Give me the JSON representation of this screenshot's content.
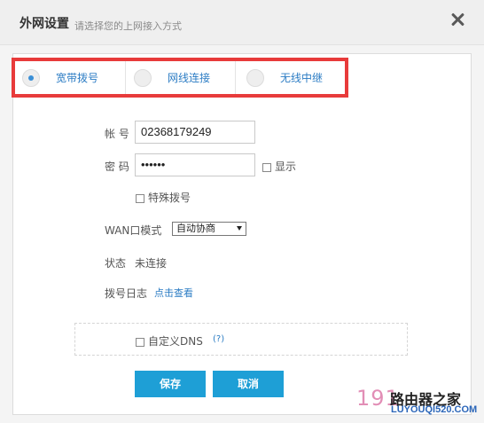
{
  "dialog": {
    "title": "外网设置",
    "subtitle": "请选择您的上网接入方式"
  },
  "tabs": [
    {
      "label": "宽带拨号",
      "selected": true
    },
    {
      "label": "网线连接",
      "selected": false
    },
    {
      "label": "无线中继",
      "selected": false
    }
  ],
  "form": {
    "account_label": "帐 号",
    "account_value": "02368179249",
    "password_label": "密 码",
    "password_value": "••••••",
    "show_label": "显示",
    "special_dial_label": "特殊拨号",
    "wan_mode_label": "WAN口模式",
    "wan_mode_value": "自动协商",
    "status_label": "状态",
    "status_value": "未连接",
    "dial_log_label": "拨号日志",
    "dial_log_link": "点击查看",
    "custom_dns_label": "自定义DNS",
    "help_link": "(?)"
  },
  "buttons": {
    "save": "保存",
    "cancel": "取消"
  },
  "watermark": {
    "number": "191",
    "brand": "路由器之家",
    "domain": "LUYOUQI520.COM"
  },
  "colors": {
    "accent": "#1e9fd6",
    "link": "#2b7cc4",
    "highlight": "#e83b3b"
  }
}
